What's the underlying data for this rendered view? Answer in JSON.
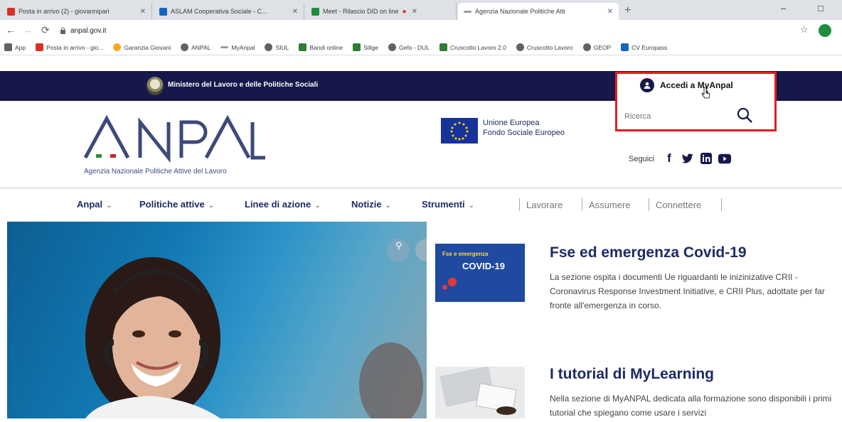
{
  "browser": {
    "tabs": [
      {
        "title": "Posta in arrivo (2) - giovannipari",
        "favicon_color": "#d93025"
      },
      {
        "title": "ASLAM Cooperativa Sociale - C...",
        "favicon_color": "#1565c0"
      },
      {
        "title": "Meet - Rilascio DID on line",
        "favicon_color": "#1e8e3e"
      },
      {
        "title": "Agenzia Nazionale Politiche Atti",
        "favicon_color": "#9e9e9e"
      }
    ],
    "close_glyph": "✕",
    "new_tab_glyph": "+",
    "minimize_glyph": "–",
    "maximize_glyph": "□",
    "url": "anpal.gov.it",
    "bookmarks": [
      {
        "label": "App",
        "color": "#5f6368"
      },
      {
        "label": "Posta in arrivo - gio...",
        "color": "#d93025"
      },
      {
        "label": "Garanzia Giovani",
        "color": "#f9a825"
      },
      {
        "label": "ANPAL",
        "color": "#5f6368"
      },
      {
        "label": "MyAnpal",
        "color": "#9e9e9e"
      },
      {
        "label": "SIUL",
        "color": "#5f6368"
      },
      {
        "label": "Bandi online",
        "color": "#2e7d32"
      },
      {
        "label": "Sillge",
        "color": "#2e7d32"
      },
      {
        "label": "Gefo - DUL",
        "color": "#5f6368"
      },
      {
        "label": "Cruscotto Lavoro 2.0",
        "color": "#2e7d32"
      },
      {
        "label": "Cruscotto Lavoro",
        "color": "#5f6368"
      },
      {
        "label": "GEOP",
        "color": "#5f6368"
      },
      {
        "label": "CV Europass",
        "color": "#1565c0"
      }
    ]
  },
  "site": {
    "gov_label": "Ministero del Lavoro e delle Politiche Sociali",
    "login_label": "Accedi a MyAnpal",
    "search_placeholder": "Ricerca",
    "logo_text": "ANPAL",
    "logo_subtitle": "Agenzia Nazionale Politiche Attive del Lavoro",
    "eu_line1": "Unione Europea",
    "eu_line2": "Fondo Sociale Europeo",
    "follow_label": "Seguici",
    "nav": [
      {
        "label": "Anpal"
      },
      {
        "label": "Politiche attive"
      },
      {
        "label": "Linee di azione"
      },
      {
        "label": "Notizie"
      },
      {
        "label": "Strumenti"
      }
    ],
    "nav_chevron": "⌄",
    "secondary_nav": [
      "Lavorare",
      "Assumere",
      "Connettere"
    ],
    "news": [
      {
        "title": "Fse ed emergenza Covid-19",
        "text": "La sezione ospita i documenti Ue riguardanti le inizinizative CRII - Coronavirus Response Investment Initiative, e CRII Plus, adottate per far fronte all'emergenza in corso.",
        "thumb_label_1": "Fse e emergenza",
        "thumb_label_2": "COVID-19"
      },
      {
        "title": "I tutorial di MyLearning",
        "text": "Nella sezione di MyANPAL dedicata alla formazione sono disponibili i primi tutorial che spiegano come usare i servizi"
      }
    ],
    "brand_navy": "#16174a",
    "highlight_red": "#e0201d"
  }
}
